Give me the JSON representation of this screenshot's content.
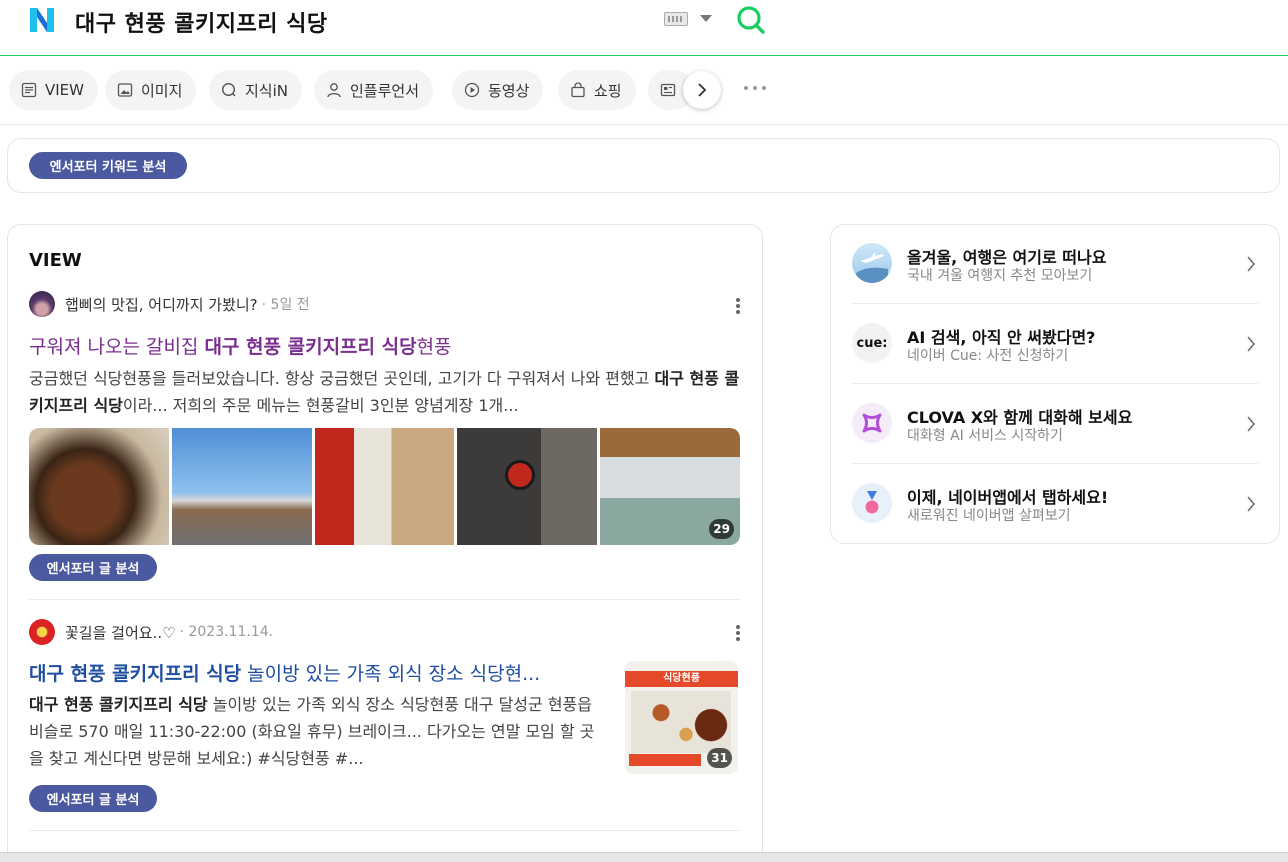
{
  "header": {
    "query": "대구 현풍 콜키지프리 식당"
  },
  "tabs": [
    {
      "label": "VIEW",
      "icon": "document-icon"
    },
    {
      "label": "이미지",
      "icon": "image-icon"
    },
    {
      "label": "지식iN",
      "icon": "search-bubble-icon"
    },
    {
      "label": "인플루언서",
      "icon": "person-icon"
    },
    {
      "label": "동영상",
      "icon": "play-icon"
    },
    {
      "label": "쇼핑",
      "icon": "bag-icon"
    }
  ],
  "keyword_pill": "엔서포터 키워드 분석",
  "view": {
    "title": "VIEW",
    "posts": [
      {
        "author": "햅삐의 맛집, 어디까지 가봤니?",
        "date": "5일 전",
        "title_pre": "구워져 나오는 갈비집 ",
        "title_bold": "대구 현풍 콜키지프리 식당",
        "title_post": "현풍",
        "desc_1": "궁금했던 식당현풍을 들러보았습니다. 항상 궁금했던 곳인데, 고기가 다 구워져서 나와 편했고 ",
        "desc_bold": "대구 현풍 콜키지프리 식당",
        "desc_2": "이라... 저희의 주문 메뉴는 현풍갈비 3인분 양념게장 1개...",
        "photo_count": "29",
        "analyze_pill": "엔서포터 글 분석"
      },
      {
        "author": "꽃길을 걸어요..♡",
        "date": "2023.11.14.",
        "title_bold": "대구 현풍 콜키지프리 식당",
        "title_post": " 놀이방 있는 가족 외식 장소 식당현...",
        "desc_bold": "대구 현풍 콜키지프리 식당",
        "desc_2": " 놀이방 있는 가족 외식 장소 식당현풍 대구 달성군 현풍읍 비슬로 570 매일 11:30-22:00 (화요일 휴무) 브레이크... 다가오는 연말 모임 할 곳을 찾고 계신다면 방문해 보세요:) #식당현풍 #...",
        "thumb_banner": "식당현풍",
        "photo_count": "31",
        "analyze_pill": "엔서포터 글 분석"
      }
    ]
  },
  "side": {
    "items": [
      {
        "title": "올겨울, 여행은 여기로 떠나요",
        "sub": "국내 겨울 여행지 추천 모아보기",
        "icon": "airplane-icon"
      },
      {
        "title": "AI 검색, 아직 안 써봤다면?",
        "sub": "네이버 Cue: 사전 신청하기",
        "icon": "cue-logo-icon",
        "icon_text": "cue:"
      },
      {
        "title": "CLOVA X와 함께 대화해 보세요",
        "sub": "대화형 AI 서비스 시작하기",
        "icon": "clova-x-icon"
      },
      {
        "title": "이제, 네이버앱에서 탭하세요!",
        "sub": "새로워진 네이버앱 살펴보기",
        "icon": "medal-icon"
      }
    ]
  },
  "colors": {
    "accent_green": "#19ce60",
    "pill_blue": "#4b5aa0",
    "visited_title": "#7a2e8f",
    "link_title": "#1f4ea0"
  }
}
